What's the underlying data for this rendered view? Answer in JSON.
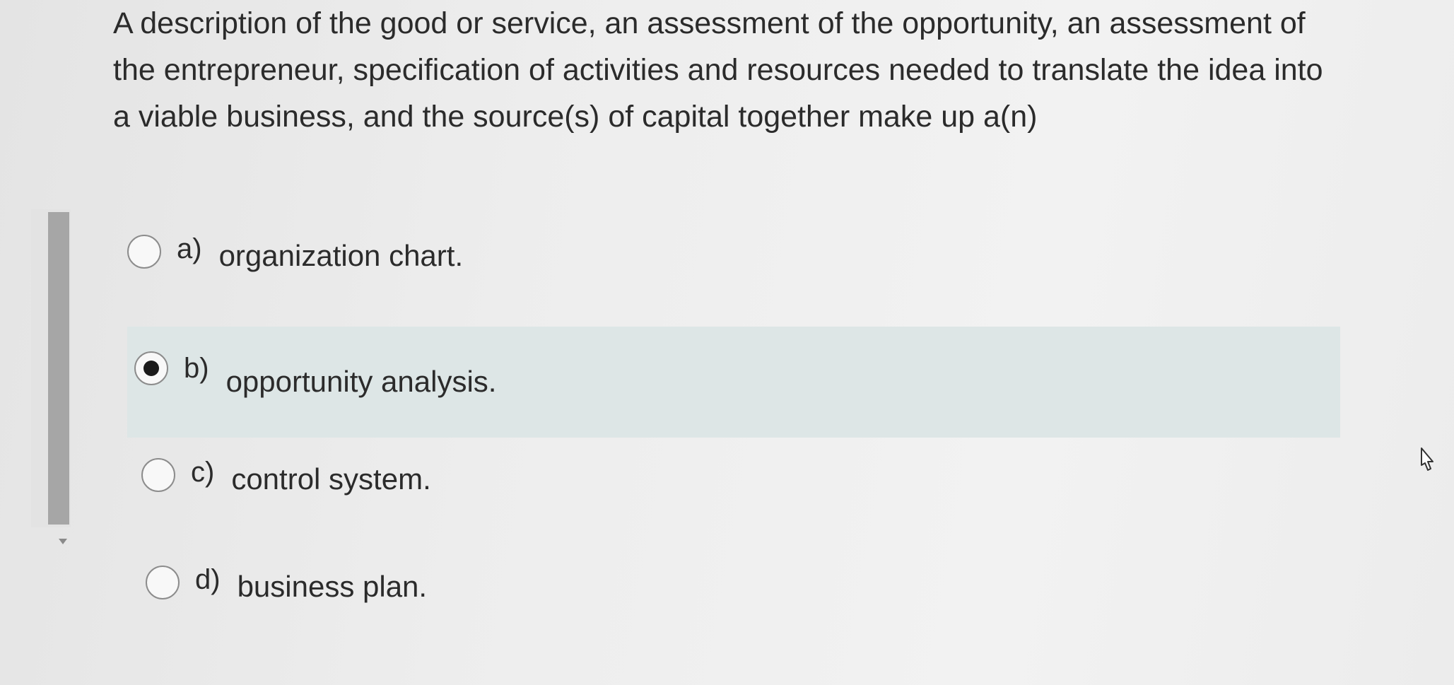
{
  "question": {
    "text": "A description of the good or service, an assessment of the opportunity, an assessment of the entrepreneur, specification of activities and resources needed to translate the idea into a viable business, and the source(s) of capital together make up a(n)"
  },
  "options": [
    {
      "letter": "a)",
      "text": "organization chart.",
      "selected": false
    },
    {
      "letter": "b)",
      "text": "opportunity analysis.",
      "selected": true
    },
    {
      "letter": "c)",
      "text": "control system.",
      "selected": false
    },
    {
      "letter": "d)",
      "text": "business plan.",
      "selected": false
    }
  ],
  "icons": {
    "radio": "radio-button",
    "cursor": "mouse-pointer-icon",
    "scroll_down": "chevron-down-icon"
  },
  "colors": {
    "selected_highlight": "#dde6e6",
    "radio_fill": "#1a1a1a"
  }
}
